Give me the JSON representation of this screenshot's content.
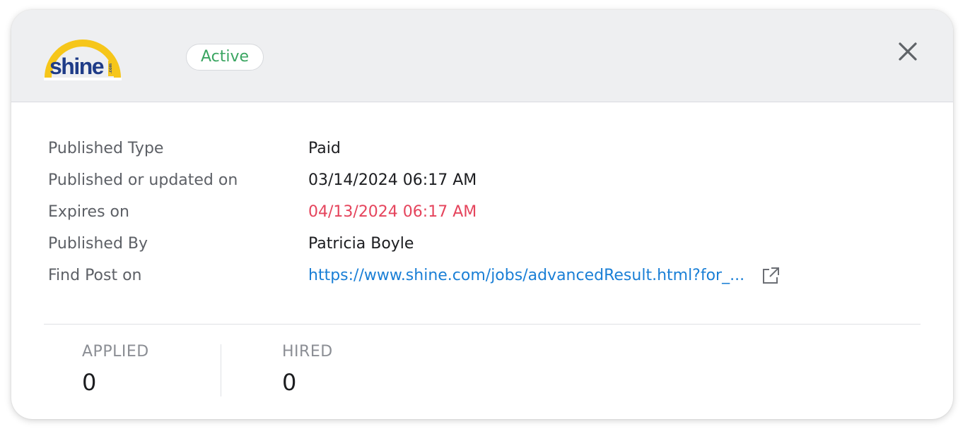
{
  "header": {
    "logo": {
      "text": "shine",
      "suffix": ".com",
      "colors": {
        "arc": "#f6c61a",
        "text": "#1f3c88"
      }
    },
    "status": "Active",
    "close_icon": "close-icon"
  },
  "details": [
    {
      "label": "Published Type",
      "value": "Paid"
    },
    {
      "label": "Published or updated on",
      "value": "03/14/2024 06:17 AM"
    },
    {
      "label": "Expires on",
      "value": "04/13/2024 06:17 AM"
    },
    {
      "label": "Published By",
      "value": "Patricia Boyle"
    },
    {
      "label": "Find Post on",
      "value": "https://www.shine.com/jobs/advancedResult.html?for_..."
    }
  ],
  "stats": {
    "applied": {
      "label": "APPLIED",
      "value": "0"
    },
    "hired": {
      "label": "HIRED",
      "value": "0"
    }
  },
  "colors": {
    "status_active": "#3aa561",
    "expiry_warning": "#e5445c",
    "link": "#1a7fd6"
  }
}
